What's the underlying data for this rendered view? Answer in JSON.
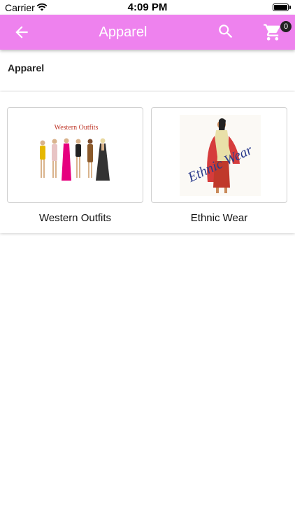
{
  "status_bar": {
    "carrier": "Carrier",
    "time": "4:09 PM",
    "wifi_icon": "wifi-icon",
    "battery_icon": "battery-icon"
  },
  "app_bar": {
    "title": "Apparel",
    "back_icon": "arrow-back-icon",
    "search_icon": "search-icon",
    "cart_icon": "cart-icon",
    "cart_count": "0",
    "color": "#ee82ee"
  },
  "section": {
    "title": "Apparel"
  },
  "categories": [
    {
      "label": "Western Outfits",
      "image_caption": "Western Outfits"
    },
    {
      "label": "Ethnic Wear",
      "image_caption": "Ethnic Wear"
    }
  ]
}
